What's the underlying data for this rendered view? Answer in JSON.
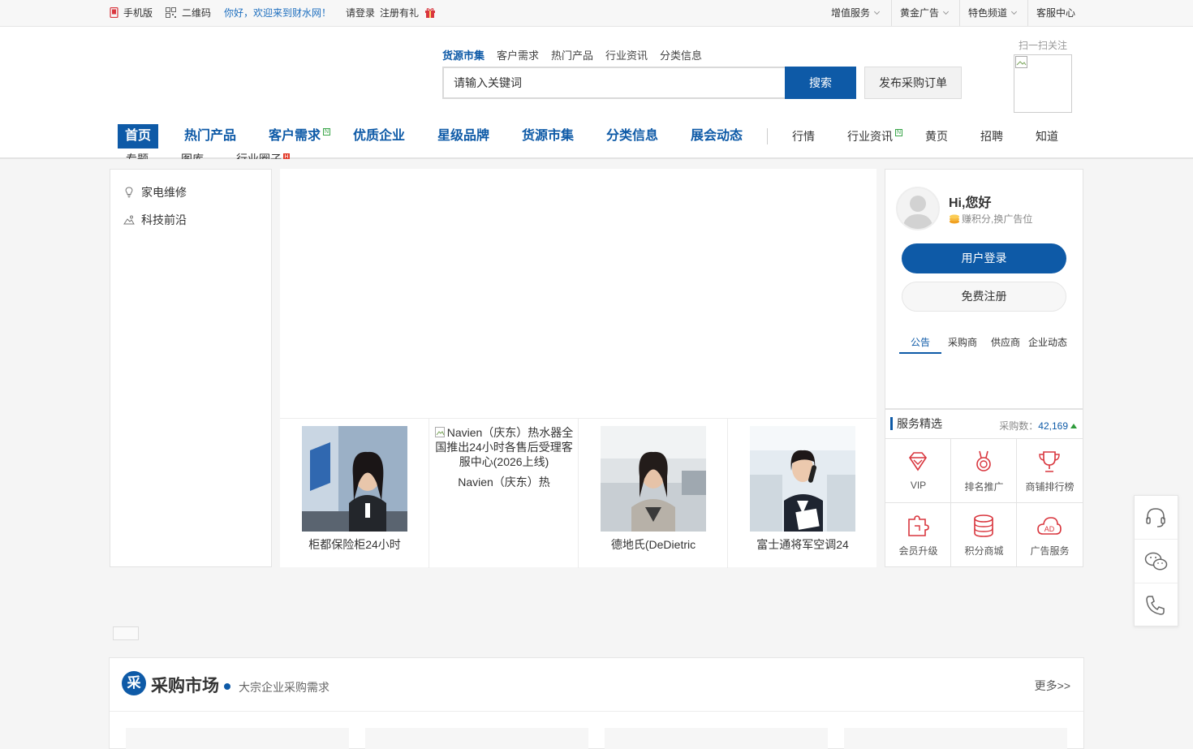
{
  "topbar": {
    "mobile": "手机版",
    "qrcode": "二维码",
    "welcome": "你好，欢迎来到财水网！",
    "login": "请登录",
    "register": "注册有礼",
    "right": [
      "增值服务",
      "黄金广告",
      "特色频道",
      "客服中心"
    ]
  },
  "search": {
    "tabs": [
      "货源市集",
      "客户需求",
      "热门产品",
      "行业资讯",
      "分类信息"
    ],
    "placeholder": "请输入关键词",
    "button": "搜索",
    "publish": "发布采购订单",
    "qr_label": "扫一扫关注"
  },
  "nav": {
    "primary": [
      "首页",
      "热门产品",
      "客户需求",
      "优质企业",
      "星级品牌",
      "货源市集",
      "分类信息",
      "展会动态"
    ],
    "secondary": [
      "行情",
      "行业资讯",
      "黄页",
      "招聘",
      "知道"
    ],
    "third": [
      "专题",
      "图库",
      "行业圈子"
    ],
    "badge_new": "N",
    "badge_hot": "H"
  },
  "categories": [
    "家电维修",
    "科技前沿"
  ],
  "thumbs": [
    {
      "caption": "柜都保险柜24小时"
    },
    {
      "alt": "Navien（庆东）热水器全国推出24小时各售后受理客服中心(2026上线)",
      "caption": "Navien（庆东）热"
    },
    {
      "caption": "德地氏(DeDietric"
    },
    {
      "caption": "富士通将军空调24"
    }
  ],
  "user": {
    "greeting": "Hi,您好",
    "earn": "赚积分,换广告位",
    "login_btn": "用户登录",
    "register_btn": "免费注册",
    "tabs": [
      "公告",
      "采购商",
      "供应商",
      "企业动态"
    ]
  },
  "services": {
    "title": "服务精选",
    "count_label": "采购数：",
    "count": "42,169",
    "items": [
      "VIP",
      "排名推广",
      "商铺排行榜",
      "会员升级",
      "积分商城",
      "广告服务"
    ]
  },
  "market": {
    "icon": "采",
    "title": "采购市场",
    "subtitle": "大宗企业采购需求",
    "more": "更多>>"
  },
  "colors": {
    "brand": "#0e5aa7",
    "accent_red": "#d9363e",
    "link_blue": "#1e6fbf"
  }
}
